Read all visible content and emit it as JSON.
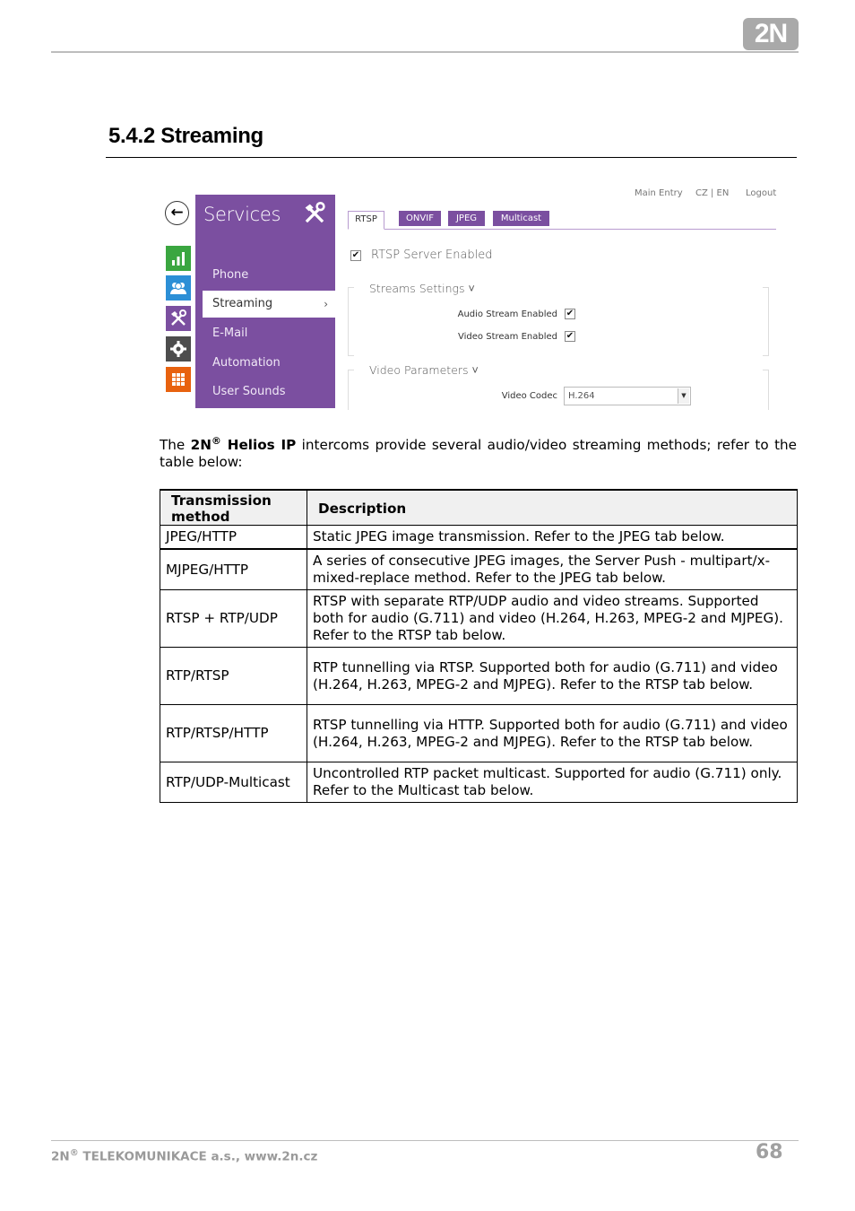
{
  "header": {
    "logo_text": "2N"
  },
  "section": {
    "title": "5.4.2 Streaming"
  },
  "screenshot": {
    "back_glyph": "←",
    "module_icons": [
      "status-chart-icon",
      "users-icon",
      "services-tools-icon",
      "settings-gear-icon",
      "apps-grid-icon"
    ],
    "menu": {
      "title": "Services",
      "items": [
        {
          "label": "Phone",
          "active": false
        },
        {
          "label": "Streaming",
          "active": true,
          "chevron": "›"
        },
        {
          "label": "E-Mail",
          "active": false
        },
        {
          "label": "Automation",
          "active": false
        },
        {
          "label": "User Sounds",
          "active": false
        }
      ]
    },
    "top_links": [
      "Main Entry",
      "CZ | EN",
      "Logout"
    ],
    "tabs": [
      {
        "label": "RTSP",
        "active": true
      },
      {
        "label": "ONVIF",
        "active": false
      },
      {
        "label": "JPEG",
        "active": false
      },
      {
        "label": "Multicast",
        "active": false
      }
    ],
    "rtsp_server": {
      "label": "RTSP Server Enabled",
      "checked": true,
      "check_glyph": "✔"
    },
    "streams_settings": {
      "legend": "Streams Settings ˅",
      "audio": {
        "label": "Audio Stream Enabled",
        "checked": true,
        "check_glyph": "✔"
      },
      "video": {
        "label": "Video Stream Enabled",
        "checked": true,
        "check_glyph": "✔"
      }
    },
    "video_parameters": {
      "legend": "Video Parameters ˅",
      "codec_label": "Video Codec",
      "codec_value": "H.264",
      "dropdown_glyph": "▼"
    }
  },
  "intro": {
    "prefix": "The ",
    "brand": "2N",
    "reg": "®",
    "product": " Helios IP",
    "suffix": " intercoms provide several audio/video streaming methods; refer to the table below:"
  },
  "table": {
    "headers": [
      "Transmission method",
      "Description"
    ],
    "rows": [
      {
        "method": "JPEG/HTTP",
        "description": "Static JPEG image transmission. Refer to the JPEG tab below."
      },
      {
        "method": "MJPEG/HTTP",
        "description": "A series of consecutive JPEG images, the Server Push - multipart/x-mixed-replace method. Refer to the JPEG tab below."
      },
      {
        "method": "RTSP + RTP/UDP",
        "description": "RTSP with separate RTP/UDP audio and video streams. Supported both for audio (G.711) and video (H.264, H.263, MPEG-2 and MJPEG). Refer to the RTSP tab below."
      },
      {
        "method": "RTP/RTSP",
        "description": "RTP tunnelling via RTSP. Supported both for audio (G.711) and video (H.264, H.263, MPEG-2 and MJPEG). Refer to the RTSP tab below."
      },
      {
        "method": "RTP/RTSP/HTTP",
        "description": "RTSP tunnelling via HTTP. Supported both for audio (G.711) and video (H.264, H.263, MPEG-2 and MJPEG). Refer to the RTSP tab below."
      },
      {
        "method": "RTP/UDP-Multicast",
        "description": "Uncontrolled RTP packet multicast. Supported for audio (G.711) only. Refer to the Multicast tab below."
      }
    ]
  },
  "footer": {
    "brand": "2N",
    "reg": "®",
    "company": " TELEKOMUNIKACE a.s., www.2n.cz",
    "page_number": "68"
  }
}
